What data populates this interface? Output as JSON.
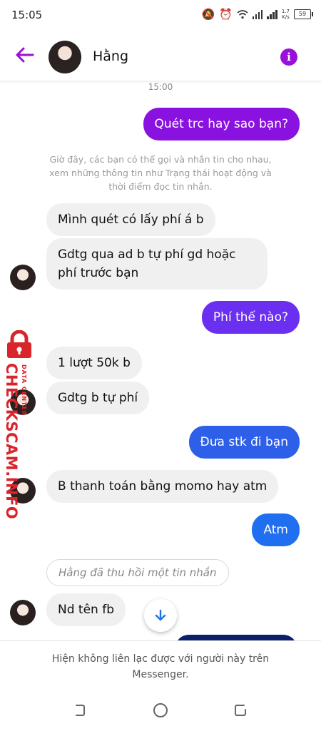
{
  "status_bar": {
    "time": "15:05",
    "net_speed_top": "1.7",
    "net_speed_bottom": "K/s",
    "battery": "59"
  },
  "header": {
    "contact_name": "Hằng"
  },
  "messages": {
    "timestamp": "15:00",
    "out_1": "Quét trc hay sao bạn?",
    "system_notice": "Giờ đây, các bạn có thể gọi và nhắn tin cho nhau, xem những thông tin như Trạng thái hoạt động và thời điểm đọc tin nhắn.",
    "in_1": "Mình quét có lấy phí á b",
    "in_2": "Gdtg qua ad b tự phí gd hoặc phí trước bạn",
    "out_2": "Phí thế nào?",
    "in_3": "1 lượt 50k b",
    "in_4": "Gdtg b tự phí",
    "out_3": "Đưa stk đi bạn",
    "in_5": "B thanh toán bằng momo hay atm",
    "out_4": "Atm",
    "unsent": "Hằng đã thu hồi một tin nhắn",
    "in_6": "Nd tên fb"
  },
  "footer": {
    "note": "Hiện không liên lạc được với người này trên Messenger."
  },
  "watermark": {
    "text": "CHECKSCAM.INFO",
    "sub": "DATA CENTER"
  },
  "colors": {
    "accent": "#9a10d8",
    "out_purple": "#8a12e0",
    "out_violet": "#6a2ff0",
    "out_blue": "#2e5fe8",
    "out_blue2": "#1f6ff0"
  }
}
